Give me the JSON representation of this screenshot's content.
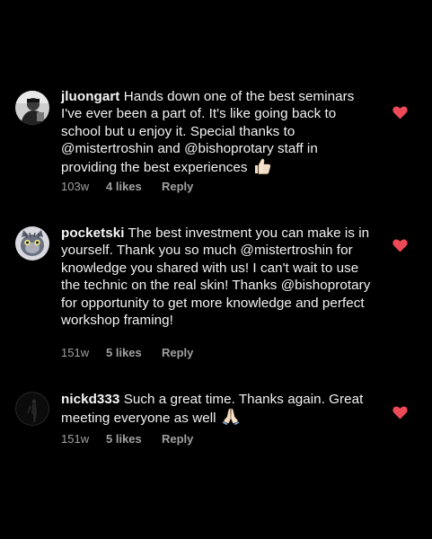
{
  "accent_heart_color": "#ed4956",
  "comments": [
    {
      "username": "jluongart",
      "text": "Hands down one of the best seminars I've ever been a part of. It's like going back to school but u enjoy it. Special thanks to @mistertroshin and @bishoprotary staff in providing the best experiences",
      "emoji": "thumbs-up",
      "time": "103w",
      "likes": "4 likes",
      "reply": "Reply",
      "avatar_icon": "person-photo-avatar"
    },
    {
      "username": "pocketski",
      "text": "The best investment you can make is in yourself. Thank you so much @mistertroshin for knowledge you shared with us! I can't wait to use the technic on the real skin!  Thanks @bishoprotary for opportunity to get more knowledge and perfect workshop framing!",
      "emoji": "",
      "time": "151w",
      "likes": "5 likes",
      "reply": "Reply",
      "avatar_icon": "cat-avatar"
    },
    {
      "username": "nickd333",
      "text": "Such a great time.  Thanks again. Great meeting everyone as well",
      "emoji": "folded-hands",
      "time": "151w",
      "likes": "5 likes",
      "reply": "Reply",
      "avatar_icon": "dark-figure-avatar"
    }
  ]
}
